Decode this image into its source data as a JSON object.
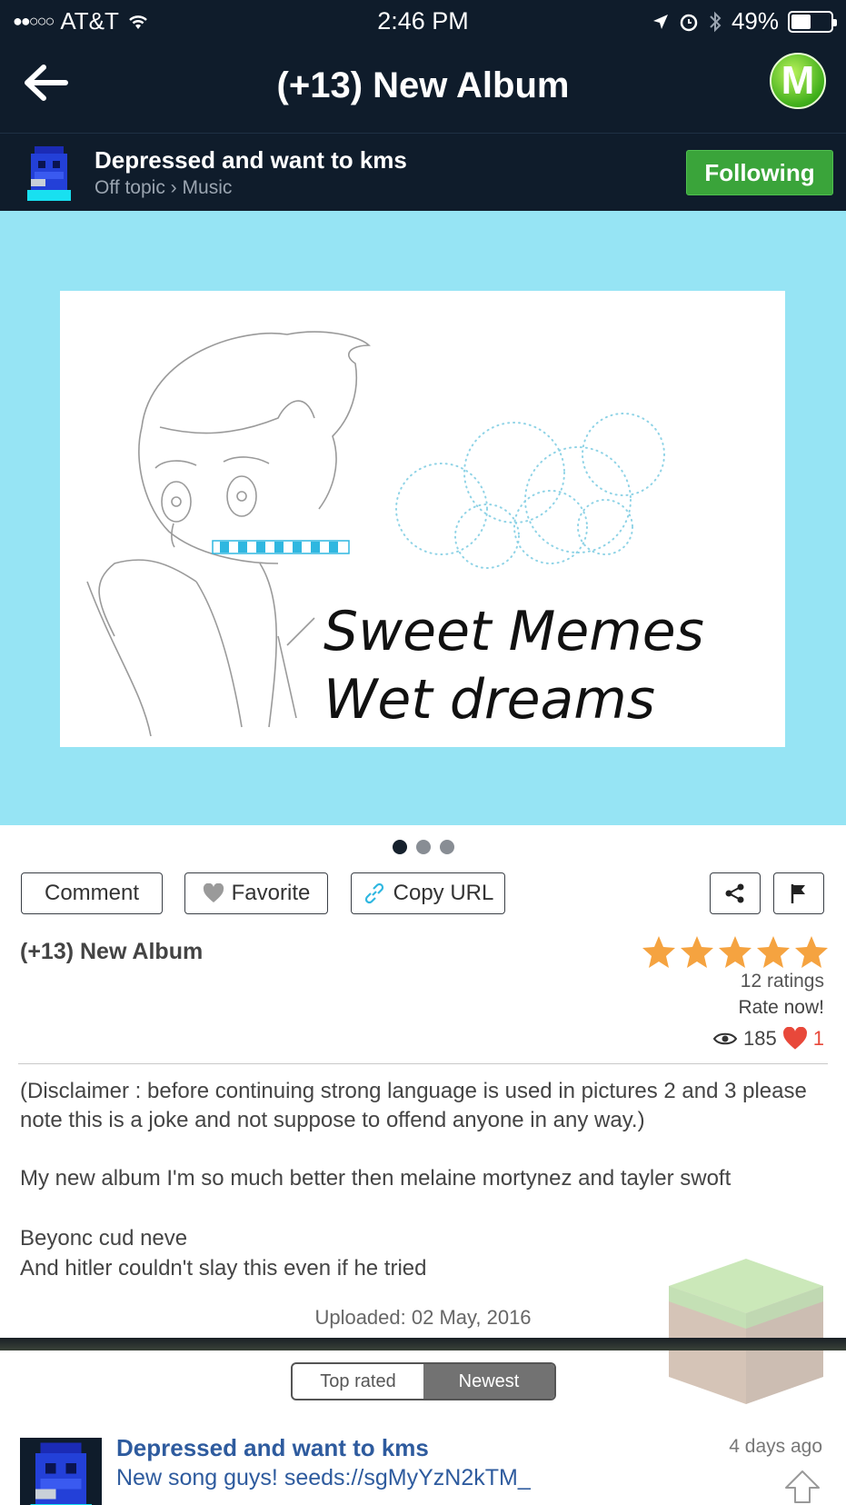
{
  "status_bar": {
    "carrier": "AT&T",
    "time": "2:46 PM",
    "battery": "49%",
    "battery_level": 0.49
  },
  "nav": {
    "title": "(+13) New Album",
    "badge_letter": "M"
  },
  "author": {
    "name": "Depressed and want to kms",
    "category_primary": "Off topic",
    "category_separator": "›",
    "category_secondary": "Music",
    "follow_label": "Following"
  },
  "artwork": {
    "line1": "Sweet Memes",
    "line2": "Wet dreams"
  },
  "gallery": {
    "current_page": 1,
    "total_pages": 3
  },
  "actions": {
    "comment_label": "Comment",
    "favorite_label": "Favorite",
    "copy_url_label": "Copy URL"
  },
  "post": {
    "title": "(+13) New Album",
    "stars": 5,
    "ratings": "12 ratings",
    "rate_now": "Rate now!",
    "views": "185",
    "likes": "1",
    "paragraph1": "(Disclaimer : before continuing strong language is used in pictures 2 and 3 please note this is a joke and not suppose to offend anyone in any way.)",
    "paragraph2": "My new album I'm so much better then melaine mortynez and tayler swoft",
    "paragraph3_line1": "Beyonc cud neve",
    "paragraph3_line2": "And hitler couldn't slay this even if he tried",
    "uploaded": "Uploaded: 02 May, 2016"
  },
  "sort": {
    "options": [
      "Top rated",
      "Newest"
    ],
    "selected": "Newest"
  },
  "comment": {
    "author": "Depressed and want to kms",
    "text": "New song guys! seeds://sgMyYzN2kTM_",
    "time": "4 days ago"
  },
  "colors": {
    "header_bg": "#0f1c2b",
    "hero_bg": "#96e4f4",
    "follow_green": "#3aa43a",
    "star_orange": "#f5a340",
    "link_blue": "#2e5b9e"
  }
}
